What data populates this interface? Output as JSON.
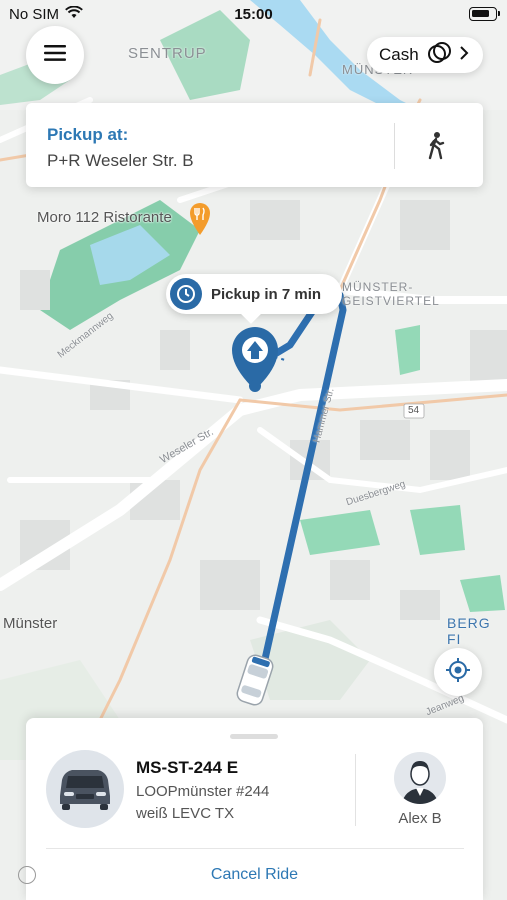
{
  "status_bar": {
    "carrier": "No SIM",
    "time": "15:00"
  },
  "map": {
    "places": {
      "sentrup": "SENTRUP",
      "muenster_top": "MÜNSTER",
      "geistviertel": "MÜNSTER-GEISTVIERTEL",
      "berg_fi": "BERG FI",
      "muenster_left": "Münster"
    },
    "streets": {
      "weseler": "Weseler Str.",
      "meckmann": "Meckmannweg",
      "duesberg": "Duesbergweg",
      "hammer": "Hammer Str.",
      "road_number": "54",
      "lepper": "Jeanweg"
    },
    "poi": "Moro 112 Ristorante",
    "colors": {
      "route": "#2e6fb0",
      "park": "#6cc49a",
      "water": "#aadaf2"
    }
  },
  "menu": {
    "icon": "hamburger-icon"
  },
  "payment": {
    "label": "Cash",
    "icon": "cash-icon"
  },
  "pickup": {
    "title": "Pickup at:",
    "address": "P+R Weseler Str. B"
  },
  "eta": {
    "label": "Pickup in 7 min"
  },
  "ride": {
    "plate": "MS-ST-244 E",
    "vehicle_name": "LOOPmünster #244",
    "vehicle_desc": "weiß LEVC TX",
    "driver_name": "Alex B",
    "cancel_label": "Cancel Ride"
  }
}
